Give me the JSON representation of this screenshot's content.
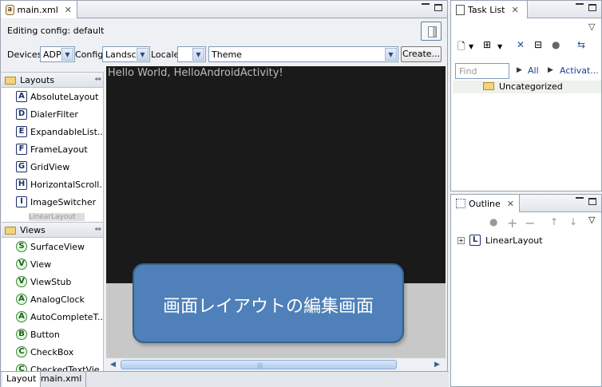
{
  "editor": {
    "tab_title": "main.xml",
    "editing_config": "Editing config: default",
    "devices_label": "Devices",
    "devices_value": "ADP",
    "config_label": "Config",
    "config_value": "Landscape",
    "locale_label": "Locale",
    "locale_value": "",
    "theme_value": "Theme",
    "create_label": "Create...",
    "hello_text": "Hello World, HelloAndroidActivity!",
    "callout": "画面レイアウトの編集画面",
    "bottom_tabs": [
      "Layout",
      "main.xml"
    ]
  },
  "palette": {
    "layouts_label": "Layouts",
    "layouts": [
      {
        "icon": "A",
        "label": "AbsoluteLayout"
      },
      {
        "icon": "D",
        "label": "DialerFilter"
      },
      {
        "icon": "E",
        "label": "ExpandableList..."
      },
      {
        "icon": "F",
        "label": "FrameLayout"
      },
      {
        "icon": "G",
        "label": "GridView"
      },
      {
        "icon": "H",
        "label": "HorizontalScroll..."
      },
      {
        "icon": "I",
        "label": "ImageSwitcher"
      }
    ],
    "linear_tip": "LinearLayout",
    "views_label": "Views",
    "views": [
      {
        "icon": "S",
        "label": "SurfaceView"
      },
      {
        "icon": "V",
        "label": "View"
      },
      {
        "icon": "V",
        "label": "ViewStub"
      },
      {
        "icon": "A",
        "label": "AnalogClock"
      },
      {
        "icon": "A",
        "label": "AutoCompleteT..."
      },
      {
        "icon": "B",
        "label": "Button"
      },
      {
        "icon": "C",
        "label": "CheckBox"
      },
      {
        "icon": "C",
        "label": "CheckedTextVie..."
      }
    ]
  },
  "tasklist": {
    "title": "Task List",
    "find_placeholder": "Find",
    "all_link": "All",
    "activate_link": "Activat...",
    "uncategorized": "Uncategorized"
  },
  "outline": {
    "title": "Outline",
    "root_icon": "L",
    "root_label": "LinearLayout"
  }
}
